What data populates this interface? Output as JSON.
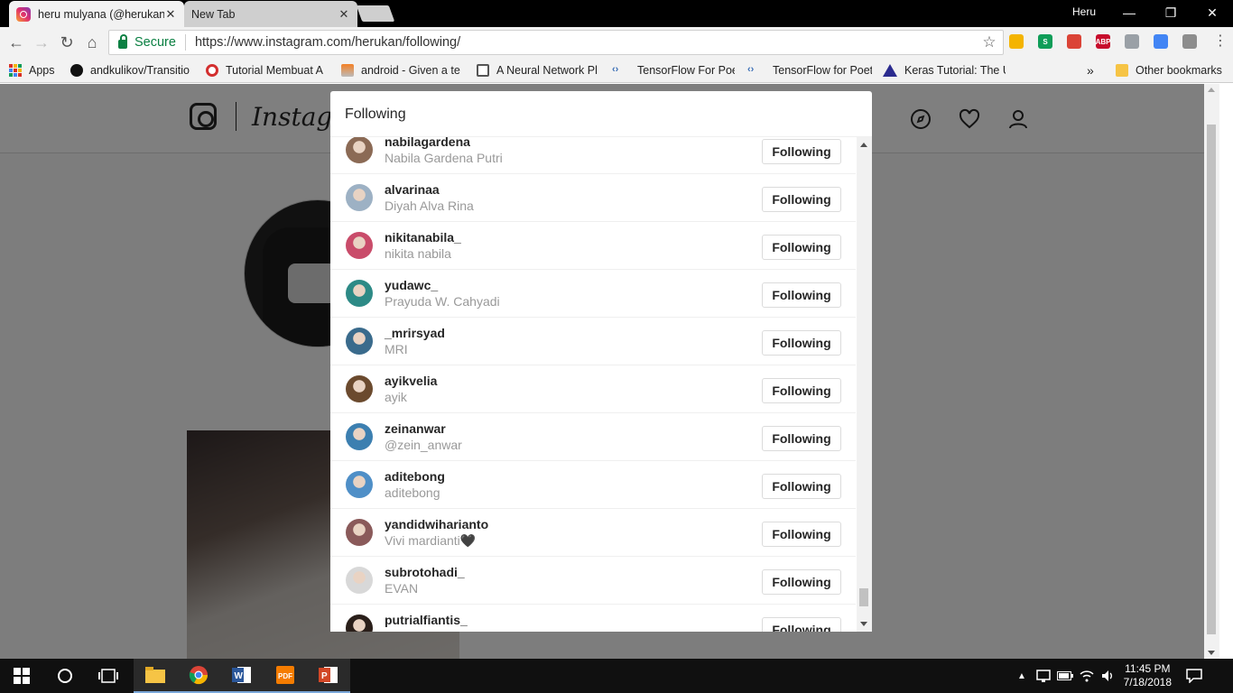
{
  "browser": {
    "tabs": [
      {
        "title": "heru mulyana (@herukan",
        "active": true
      },
      {
        "title": "New Tab",
        "active": false
      }
    ],
    "window_user": "Heru",
    "window_controls": {
      "minimize": "—",
      "restore": "❐",
      "close": "✕"
    },
    "secure_label": "Secure",
    "url": "https://www.instagram.com/herukan/following/",
    "bookmarks": [
      {
        "label": "Apps"
      },
      {
        "label": "andkulikov/Transitio"
      },
      {
        "label": "Tutorial Membuat A"
      },
      {
        "label": "android - Given a te"
      },
      {
        "label": "A Neural Network Pl"
      },
      {
        "label": "TensorFlow For Poet"
      },
      {
        "label": "TensorFlow for Poets"
      },
      {
        "label": "Keras Tutorial: The U"
      }
    ],
    "bookmarks_overflow": "»",
    "other_bookmarks": "Other bookmarks",
    "extensions": [
      {
        "name": "colors-ext-icon",
        "color": "#f4b400",
        "text": ""
      },
      {
        "name": "s-ext-icon",
        "color": "#0f9d58",
        "text": "S"
      },
      {
        "name": "pin-ext-icon",
        "color": "#db4437",
        "text": ""
      },
      {
        "name": "adblock-plus-icon",
        "color": "#c70d2c",
        "text": "ABP"
      },
      {
        "name": "shield-ext-icon",
        "color": "#9aa0a6",
        "text": ""
      },
      {
        "name": "refresh-ext-icon",
        "color": "#4285f4",
        "text": ""
      },
      {
        "name": "image-ext-icon",
        "color": "#8d8d8d",
        "text": ""
      }
    ]
  },
  "instagram": {
    "wordmark": "Instagram",
    "modal": {
      "title": "Following",
      "button_label": "Following",
      "users": [
        {
          "username": "nabilagardena",
          "fullname": "Nabila Gardena Putri",
          "avatar_color": "#8b6a55"
        },
        {
          "username": "alvarinaa",
          "fullname": "Diyah Alva Rina",
          "avatar_color": "#9db1c4"
        },
        {
          "username": "nikitanabila_",
          "fullname": "nikita nabila",
          "avatar_color": "#c94c6a"
        },
        {
          "username": "yudawc_",
          "fullname": "Prayuda W. Cahyadi",
          "avatar_color": "#2d8a86"
        },
        {
          "username": "_mrirsyad",
          "fullname": "MRI",
          "avatar_color": "#3a6b8c"
        },
        {
          "username": "ayikvelia",
          "fullname": "ayik",
          "avatar_color": "#6b4a2e"
        },
        {
          "username": "zeinanwar",
          "fullname": "@zein_anwar",
          "avatar_color": "#3c7fb0"
        },
        {
          "username": "aditebong",
          "fullname": "aditebong",
          "avatar_color": "#4f8fc7"
        },
        {
          "username": "yandidwiharianto",
          "fullname": "Vivi mardianti🖤",
          "avatar_color": "#8a5a5a"
        },
        {
          "username": "subrotohadi_",
          "fullname": "EVAN",
          "avatar_color": "#d8d8d8"
        },
        {
          "username": "putrialfiantis_",
          "fullname": "",
          "avatar_color": "#2a1f1a"
        }
      ]
    }
  },
  "taskbar": {
    "time": "11:45 PM",
    "date": "7/18/2018"
  }
}
